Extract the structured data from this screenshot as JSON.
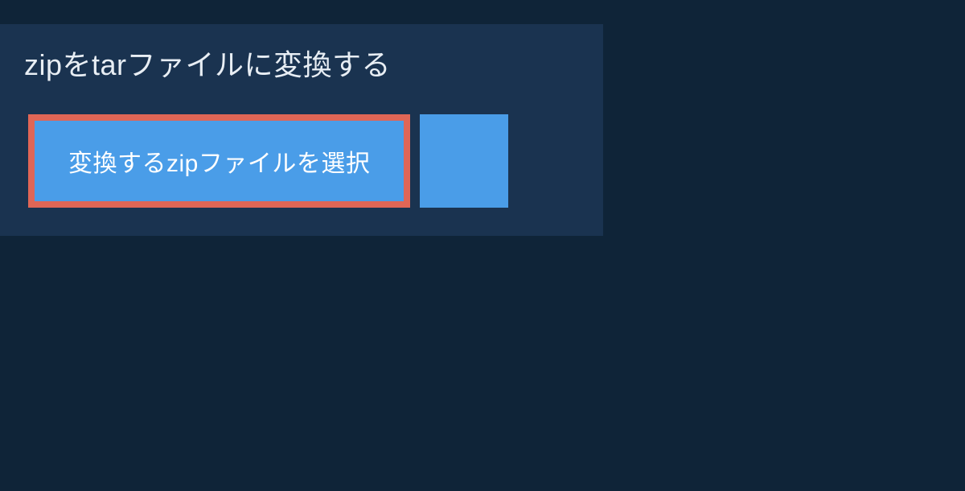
{
  "heading": "zipをtarファイルに変換する",
  "buttons": {
    "select_label": "変換するzipファイルを選択"
  }
}
